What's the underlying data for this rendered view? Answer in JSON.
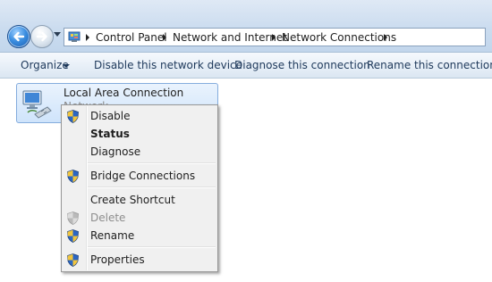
{
  "address_bar": {
    "breadcrumbs": [
      "Control Panel",
      "Network and Internet",
      "Network Connections"
    ]
  },
  "command_bar": {
    "organize": "Organize",
    "disable_device": "Disable this network device",
    "diagnose": "Diagnose this connection",
    "rename": "Rename this connection"
  },
  "connection": {
    "name": "Local Area Connection",
    "status": "Network"
  },
  "context_menu": {
    "disable": "Disable",
    "status": "Status",
    "diagnose": "Diagnose",
    "bridge": "Bridge Connections",
    "shortcut": "Create Shortcut",
    "delete": "Delete",
    "rename": "Rename",
    "properties": "Properties"
  },
  "colors": {
    "address_bar_bg": "#cbdcef",
    "command_bar_bg": "#e9f0f8",
    "selection_bg": "#cfe4fb",
    "menu_bg": "#f0f0f0"
  }
}
